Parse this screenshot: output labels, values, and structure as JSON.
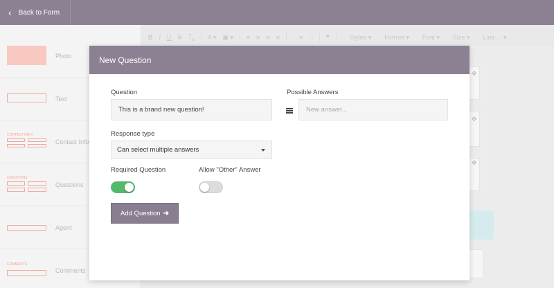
{
  "topbar": {
    "back_label": "Back to Form",
    "back_icon": "chevron-left-icon"
  },
  "sidebar": {
    "items": [
      {
        "label": "Photo",
        "thumb_text": ""
      },
      {
        "label": "Text",
        "thumb_text": ""
      },
      {
        "label": "Contact Info",
        "thumb_text": "CONTACT INFO"
      },
      {
        "label": "Questions",
        "thumb_text": "QUESTIONS"
      },
      {
        "label": "Agent",
        "thumb_text": ""
      },
      {
        "label": "Comments",
        "thumb_text": "COMMENTS"
      }
    ]
  },
  "toolbar": {
    "styles": "Styles",
    "format": "Format",
    "font": "Font",
    "size": "Size",
    "line": "Line ..."
  },
  "modal": {
    "title": "New Question",
    "question_label": "Question",
    "question_value": "This is a brand new question!",
    "answers_label": "Possible Answers",
    "answer_placeholder": "New answer...",
    "response_type_label": "Response type",
    "response_type_value": "Can select multiple answers",
    "required_label": "Required Question",
    "required_on": true,
    "allow_other_label": "Allow \"Other\" Answer",
    "allow_other_on": false,
    "add_button_label": "Add Question",
    "add_button_icon": "arrow-right-icon"
  },
  "colors": {
    "accent": "#8b8193",
    "toggle_on": "#53ba6a",
    "thumb": "#f2a79c"
  }
}
